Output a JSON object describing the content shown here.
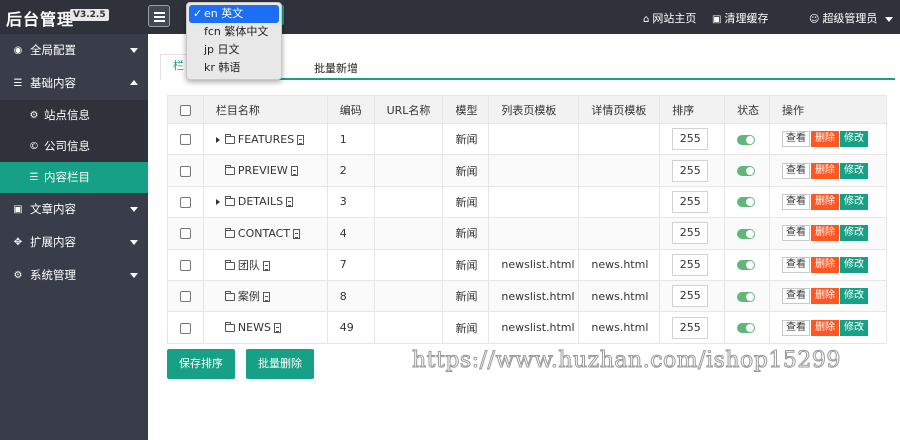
{
  "header": {
    "title": "后台管理",
    "version": "V3.2.5",
    "links": [
      {
        "icon": "home-icon",
        "label": "网站主页"
      },
      {
        "icon": "trash-icon",
        "label": "清理缓存"
      },
      {
        "icon": "user-icon",
        "label": "超级管理员"
      }
    ]
  },
  "language_menu": {
    "options": [
      {
        "code": "en",
        "label": "en 英文",
        "selected": true
      },
      {
        "code": "fcn",
        "label": "fcn 繁体中文",
        "selected": false
      },
      {
        "code": "jp",
        "label": "jp 日文",
        "selected": false
      },
      {
        "code": "kr",
        "label": "kr 韩语",
        "selected": false
      }
    ]
  },
  "sidebar": {
    "items": [
      {
        "label": "全局配置",
        "icon": "globe-icon"
      },
      {
        "label": "基础内容",
        "icon": "sliders-icon",
        "expanded": true,
        "children": [
          {
            "label": "站点信息",
            "icon": "gear-icon"
          },
          {
            "label": "公司信息",
            "icon": "copyright-icon"
          },
          {
            "label": "内容栏目",
            "icon": "list-icon",
            "active": true
          }
        ]
      },
      {
        "label": "文章内容",
        "icon": "file-icon"
      },
      {
        "label": "扩展内容",
        "icon": "expand-icon"
      },
      {
        "label": "系统管理",
        "icon": "gear-icon"
      }
    ]
  },
  "tabs": [
    {
      "label": "栏",
      "active": true
    },
    {
      "label": "批量新增",
      "active": false
    }
  ],
  "table": {
    "headers": [
      "",
      "栏目名称",
      "编码",
      "URL名称",
      "模型",
      "列表页模板",
      "详情页模板",
      "排序",
      "状态",
      "操作"
    ],
    "rows": [
      {
        "name": "FEATURES",
        "has_children": true,
        "code": "1",
        "url": "",
        "model": "新闻",
        "list_tpl": "",
        "detail_tpl": "",
        "sort": "255"
      },
      {
        "name": "PREVIEW",
        "has_children": false,
        "code": "2",
        "url": "",
        "model": "新闻",
        "list_tpl": "",
        "detail_tpl": "",
        "sort": "255"
      },
      {
        "name": "DETAILS",
        "has_children": true,
        "code": "3",
        "url": "",
        "model": "新闻",
        "list_tpl": "",
        "detail_tpl": "",
        "sort": "255"
      },
      {
        "name": "CONTACT",
        "has_children": false,
        "code": "4",
        "url": "",
        "model": "新闻",
        "list_tpl": "",
        "detail_tpl": "",
        "sort": "255"
      },
      {
        "name": "团队",
        "has_children": false,
        "code": "7",
        "url": "",
        "model": "新闻",
        "list_tpl": "newslist.html",
        "detail_tpl": "news.html",
        "sort": "255"
      },
      {
        "name": "案例",
        "has_children": false,
        "code": "8",
        "url": "",
        "model": "新闻",
        "list_tpl": "newslist.html",
        "detail_tpl": "news.html",
        "sort": "255"
      },
      {
        "name": "NEWS",
        "has_children": false,
        "code": "49",
        "url": "",
        "model": "新闻",
        "list_tpl": "newslist.html",
        "detail_tpl": "news.html",
        "sort": "255"
      }
    ],
    "actions": {
      "view": "查看",
      "delete": "删除",
      "edit": "修改"
    }
  },
  "buttons": {
    "save_sort": "保存排序",
    "batch_delete": "批量删除"
  },
  "watermark": "https://www.huzhan.com/ishop15299",
  "colors": {
    "header_bg": "#2f323a",
    "sidebar_bg": "#393d49",
    "accent": "#16a085",
    "danger": "#ff5722",
    "switch_on": "#5fb878",
    "menu_selected": "#1c6ef2"
  }
}
